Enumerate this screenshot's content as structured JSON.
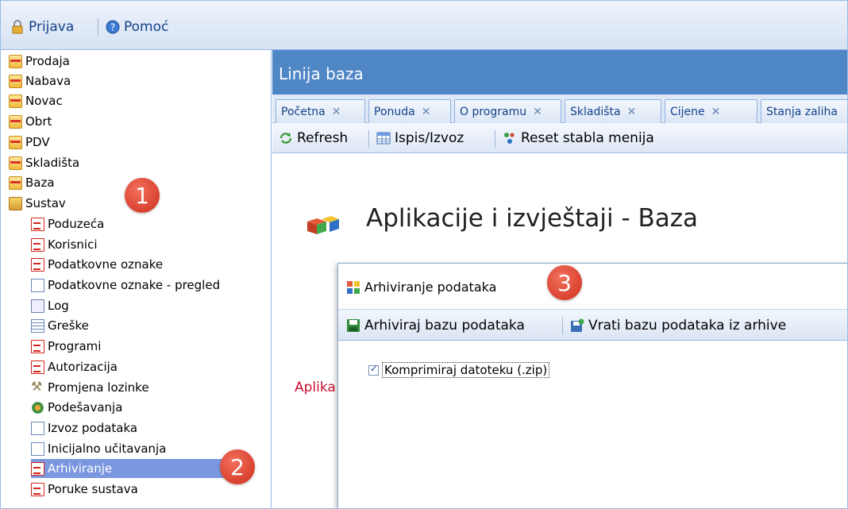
{
  "topbar": {
    "login_label": "Prijava",
    "help_label": "Pomoć"
  },
  "tree": {
    "items": [
      {
        "label": "Prodaja",
        "icon": "folder-icon"
      },
      {
        "label": "Nabava",
        "icon": "folder-icon"
      },
      {
        "label": "Novac",
        "icon": "folder-icon"
      },
      {
        "label": "Obrt",
        "icon": "folder-icon"
      },
      {
        "label": "PDV",
        "icon": "folder-icon"
      },
      {
        "label": "Skladišta",
        "icon": "folder-icon"
      },
      {
        "label": "Baza",
        "icon": "folder-icon"
      },
      {
        "label": "Sustav",
        "icon": "open-folder-icon"
      },
      {
        "label": "Poduzeća",
        "icon": "document-icon"
      },
      {
        "label": "Korisnici",
        "icon": "document-icon"
      },
      {
        "label": "Podatkovne oznake",
        "icon": "document-icon"
      },
      {
        "label": "Podatkovne oznake - pregled",
        "icon": "blank-page-icon"
      },
      {
        "label": "Log",
        "icon": "log-icon"
      },
      {
        "label": "Greške",
        "icon": "grid-icon"
      },
      {
        "label": "Programi",
        "icon": "document-icon"
      },
      {
        "label": "Autorizacija",
        "icon": "document-icon"
      },
      {
        "label": "Promjena lozinke",
        "icon": "key-icon"
      },
      {
        "label": "Podešavanja",
        "icon": "settings-icon"
      },
      {
        "label": "Izvoz podataka",
        "icon": "blank-page-icon"
      },
      {
        "label": "Inicijalno učitavanja",
        "icon": "blank-page-icon"
      },
      {
        "label": "Arhiviranje",
        "icon": "document-icon",
        "selected": true
      },
      {
        "label": "Poruke sustava",
        "icon": "document-icon"
      }
    ]
  },
  "panel": {
    "title": "Linija baza",
    "tabs": [
      "Početna",
      "Ponuda",
      "O programu",
      "Skladišta",
      "Cijene",
      "Stanja zaliha"
    ],
    "toolbar": {
      "refresh_label": "Refresh",
      "print_label": "Ispis/Izvoz",
      "reset_label": "Reset stabla menija"
    },
    "heading": "Aplikacije i izvještaji - Baza",
    "partial_text": "Aplika"
  },
  "dialog": {
    "title": "Arhiviranje podataka",
    "archive_label": "Arhiviraj bazu podataka",
    "restore_label": "Vrati bazu podataka iz arhive",
    "checkbox_label": "Komprimiraj datoteku (.zip)",
    "checkbox_checked": true
  },
  "callouts": [
    "1",
    "2",
    "3"
  ],
  "colors": {
    "header_blue": "#4f86c6",
    "selection": "#7b97e0",
    "callout_red": "#d9422f",
    "link_red": "#c8102e"
  }
}
